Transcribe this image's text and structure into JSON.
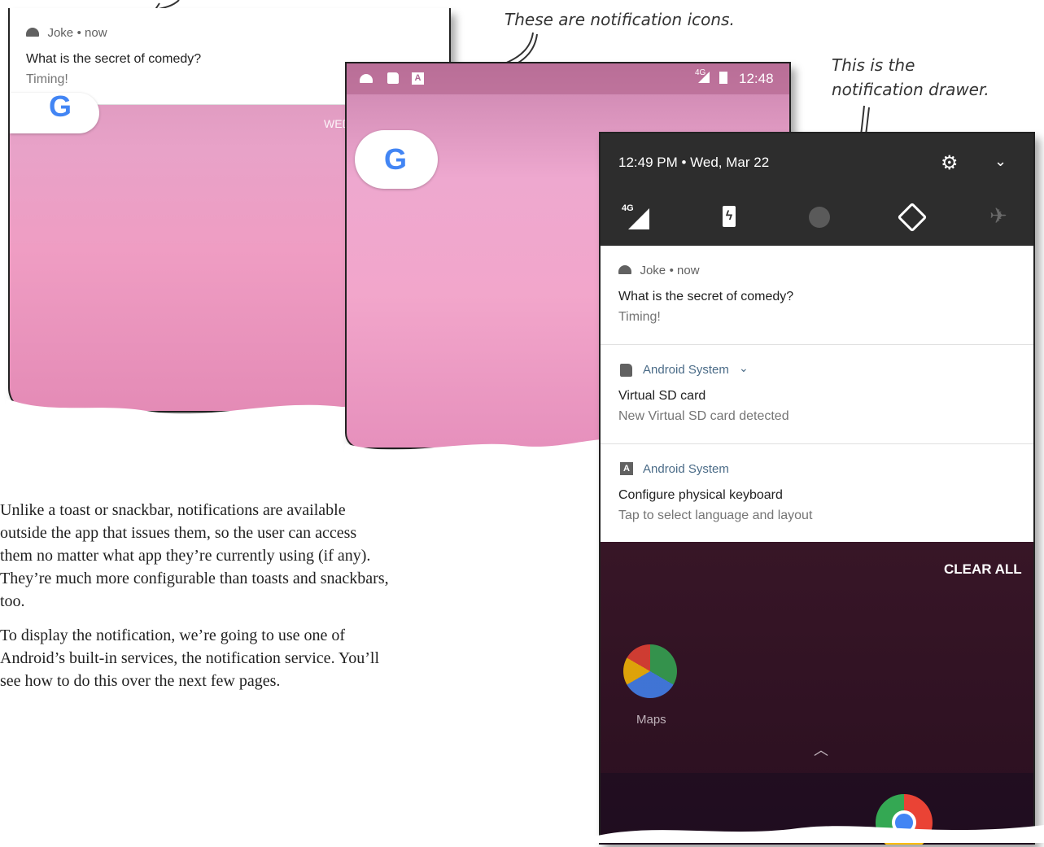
{
  "left_screen": {
    "notification": {
      "app": "Joke",
      "time": "now",
      "title": "What is the secret of comedy?",
      "text": "Timing!"
    },
    "date_fragment": "WED"
  },
  "middle_screen": {
    "status_icons": [
      "android-icon",
      "sd-card-icon",
      "keyboard-icon"
    ],
    "network": "4G",
    "time": "12:48",
    "google_letter": "G"
  },
  "drawer": {
    "time_date": "12:49 PM • Wed, Mar 22",
    "quick_settings": [
      {
        "name": "4G",
        "icon": "signal-icon"
      },
      {
        "name": "battery",
        "icon": "battery-charging-icon"
      },
      {
        "name": "data-saver",
        "icon": "data-saver-icon"
      },
      {
        "name": "auto-rotate",
        "icon": "auto-rotate-icon"
      },
      {
        "name": "airplane-mode",
        "icon": "airplane-icon"
      }
    ],
    "network_label": "4G",
    "notifications": [
      {
        "app": "Joke",
        "time": "now",
        "title": "What is the secret of comedy?",
        "text": "Timing!"
      },
      {
        "app": "Android System",
        "title": "Virtual SD card",
        "text": "New Virtual SD card detected"
      },
      {
        "app": "Android System",
        "title": "Configure physical keyboard",
        "text": "Tap to select language and layout"
      }
    ],
    "clear_all": "CLEAR ALL",
    "maps_label": "Maps",
    "colors": {
      "drawer_bg": "#2d2d2d",
      "home_bg": "#4a1e35",
      "sys_app": "#4a6b87"
    }
  },
  "annotations": {
    "icons_note": "These are notification icons.",
    "drawer_note_line1": "This is the",
    "drawer_note_line2": "notification drawer."
  },
  "body_text": {
    "para1_l1": "Unlike a toast or snackbar, notifications are available",
    "para1_l2": "outside the app that issues them, so the user can access",
    "para1_l3": "them no matter what app they’re currently using (if any).",
    "para1_l4": "They’re much more configurable than toasts and snackbars,",
    "para1_l5": "too.",
    "para2_l1": "To display the notification, we’re going to use one of",
    "para2_l2": "Android’s built-in services, the notification service. You’ll",
    "para2_l3": "see how to do this over the next few pages."
  }
}
